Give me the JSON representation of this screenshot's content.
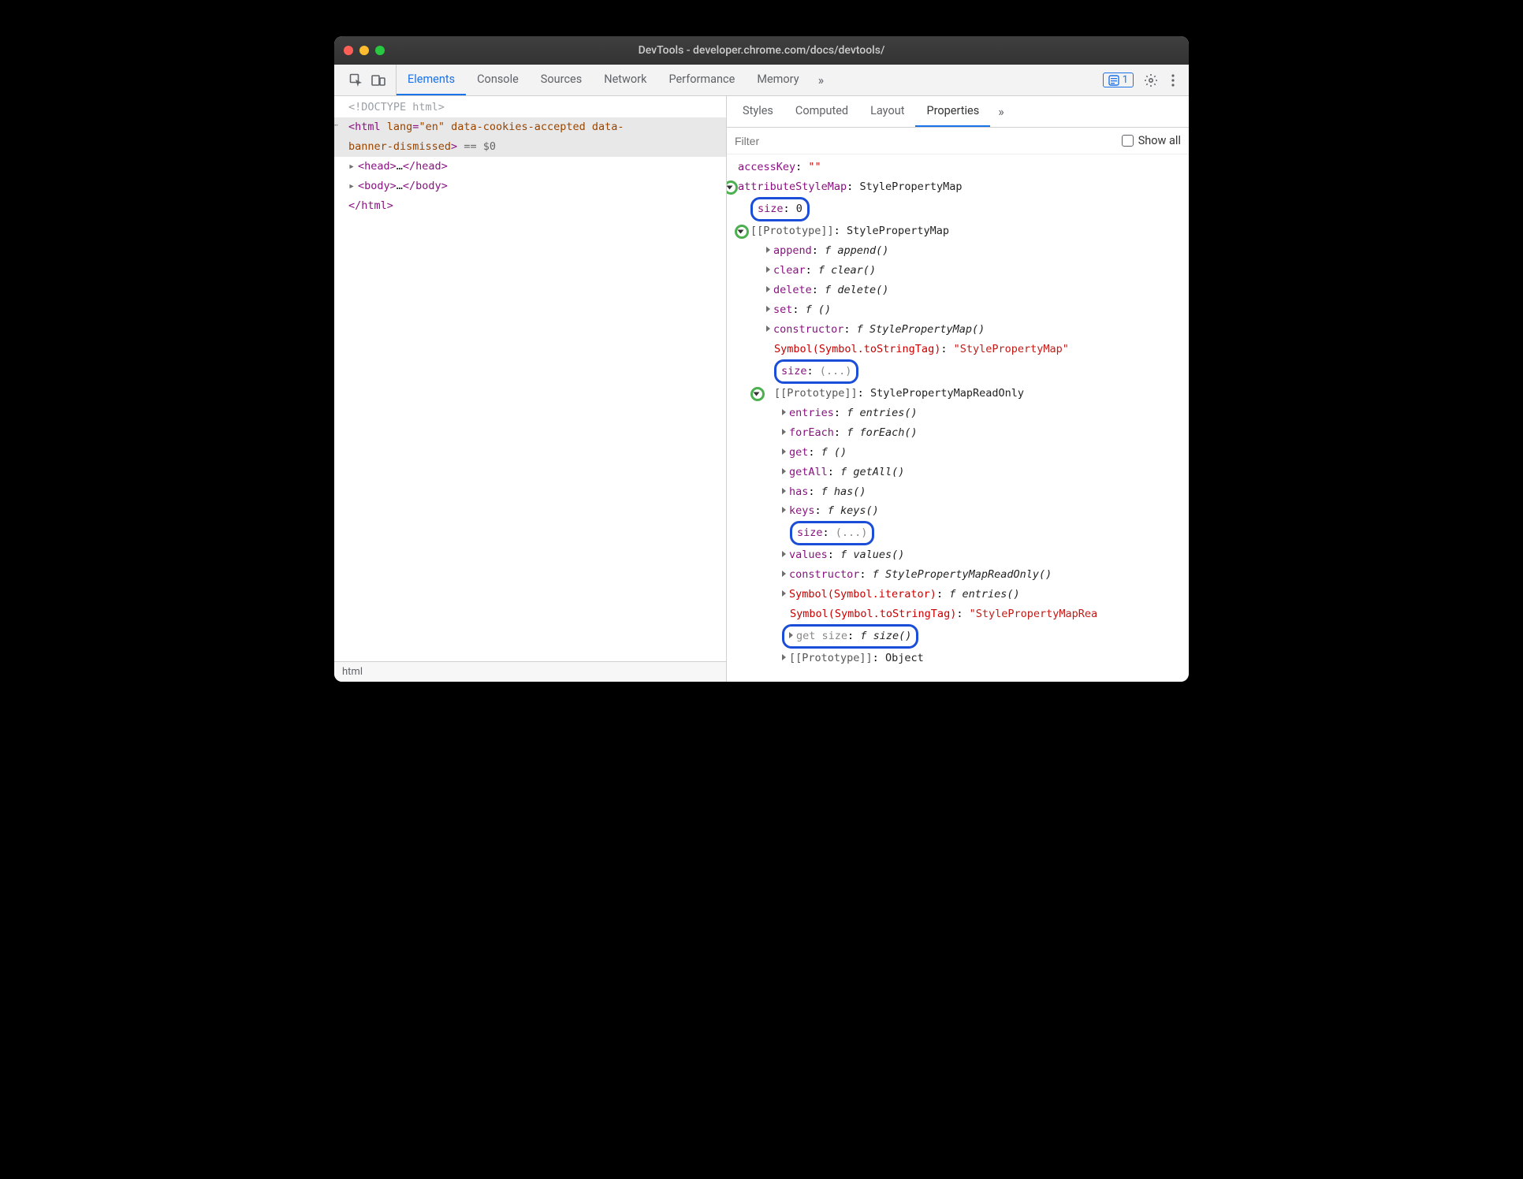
{
  "title": "DevTools - developer.chrome.com/docs/devtools/",
  "toolbar": {
    "tabs": [
      "Elements",
      "Console",
      "Sources",
      "Network",
      "Performance",
      "Memory"
    ],
    "activeTab": "Elements",
    "issuesCount": "1"
  },
  "dom": {
    "doctype": "<!DOCTYPE html>",
    "htmlOpen": "<html lang=\"en\" data-cookies-accepted data-banner-dismissed>",
    "eqDollar": "== $0",
    "head": "<head>…</head>",
    "body": "<body>…</body>",
    "htmlClose": "</html>"
  },
  "crumbs": "html",
  "rightTabs": {
    "items": [
      "Styles",
      "Computed",
      "Layout",
      "Properties"
    ],
    "active": "Properties"
  },
  "filter": {
    "placeholder": "Filter",
    "showAll": "Show all"
  },
  "props": {
    "accessKey": {
      "k": "accessKey",
      "v": "\"\""
    },
    "attributeStyleMap": {
      "k": "attributeStyleMap",
      "v": "StylePropertyMap"
    },
    "size0": {
      "k": "size",
      "v": "0"
    },
    "proto1": {
      "k": "[[Prototype]]",
      "v": "StylePropertyMap"
    },
    "append": {
      "k": "append",
      "f": "append()"
    },
    "clear": {
      "k": "clear",
      "f": "clear()"
    },
    "delete": {
      "k": "delete",
      "f": "delete()"
    },
    "set": {
      "k": "set",
      "f": "()"
    },
    "constructor1": {
      "k": "constructor",
      "f": "StylePropertyMap()"
    },
    "symStr1": {
      "k": "Symbol(Symbol.toStringTag)",
      "v": "\"StylePropertyMap\""
    },
    "sizeDots1": {
      "k": "size",
      "v": "(...)"
    },
    "proto2": {
      "k": "[[Prototype]]",
      "v": "StylePropertyMapReadOnly"
    },
    "entries": {
      "k": "entries",
      "f": "entries()"
    },
    "forEach": {
      "k": "forEach",
      "f": "forEach()"
    },
    "get": {
      "k": "get",
      "f": "()"
    },
    "getAll": {
      "k": "getAll",
      "f": "getAll()"
    },
    "has": {
      "k": "has",
      "f": "has()"
    },
    "keys": {
      "k": "keys",
      "f": "keys()"
    },
    "sizeDots2": {
      "k": "size",
      "v": "(...)"
    },
    "values": {
      "k": "values",
      "f": "values()"
    },
    "constructor2": {
      "k": "constructor",
      "f": "StylePropertyMapReadOnly()"
    },
    "symIter": {
      "k": "Symbol(Symbol.iterator)",
      "f": "entries()"
    },
    "symStr2": {
      "k": "Symbol(Symbol.toStringTag)",
      "v": "\"StylePropertyMapRea"
    },
    "getSize": {
      "k": "get size",
      "f": "size()"
    },
    "proto3": {
      "k": "[[Prototype]]",
      "v": "Object"
    }
  }
}
